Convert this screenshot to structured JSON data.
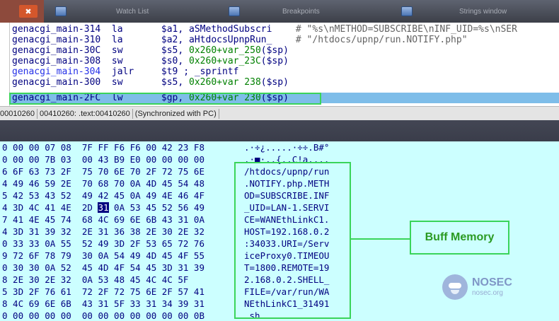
{
  "tabs": [
    {
      "label": "",
      "close": "✖"
    },
    {
      "label": "Watch List"
    },
    {
      "label": "Breakpoints"
    },
    {
      "label": "Strings window"
    }
  ],
  "disassembly": [
    {
      "addr": "genacgi_main-314",
      "op": "la",
      "args": "$a1, aSMethodSubscri",
      "comment": "# \"%s\\nMETHOD=SUBSCRIBE\\nINF_UID=%s\\nSER"
    },
    {
      "addr": "genacgi_main-310",
      "op": "la",
      "args": "$a2, aHtdocsUpnpRun_",
      "comment": "# \"/htdocs/upnp/run.NOTIFY.php\""
    },
    {
      "addr": "genacgi_main-30C",
      "op": "sw",
      "args_pre": "$s5, ",
      "args_num": "0x260+var_250",
      "args_post": "($sp)"
    },
    {
      "addr": "genacgi_main-308",
      "op": "sw",
      "args_pre": "$s0, ",
      "args_num": "0x260+var_23C",
      "args_post": "($sp)"
    },
    {
      "addr": "genacgi_main-304",
      "op": "jalr",
      "args": "$t9 ; _sprintf"
    },
    {
      "addr": "genacgi_main-300",
      "op": "sw",
      "args_pre": "$s5, ",
      "args_num": "0x260+var 238",
      "args_post": "($sp)"
    },
    {
      "addr": "genacgi_main-2FC",
      "op": "lw",
      "args_pre": "$gp, ",
      "args_num": "0x260+var 230",
      "args_post": "($sp)"
    }
  ],
  "status": {
    "offset": "00010260",
    "location": "00410260: .text:00410260",
    "sync": "(Synchronized with PC)"
  },
  "hex_rows": [
    {
      "pre": "0 00 00 07 08  7F FF F6 F6 00 42 23 F8  ",
      "ascii": ".·÷¿.....·÷÷.B#°"
    },
    {
      "pre": "0 00 00 7B 03  00 43 B9 E0 00 00 00 00  ",
      "ascii": ".·■·..{..C!a...."
    },
    {
      "pre": "6 6F 63 73 2F  75 70 6E 70 2F 72 75 6E  ",
      "ascii": "/htdocs/upnp/run"
    },
    {
      "pre": "4 49 46 59 2E  70 68 70 0A 4D 45 54 48  ",
      "ascii": ".NOTIFY.php.METH"
    },
    {
      "pre": "5 42 53 43 52  49 42 45 0A 49 4E 46 4F  ",
      "ascii": "OD=SUBSCRIBE.INF"
    },
    {
      "pre": "4 3D 4C 41 4E  2D ",
      "sel": "31",
      "post": " 0A 53 45 52 56 49  ",
      "ascii": "_UID=LAN-1.SERVI"
    },
    {
      "pre": "7 41 4E 45 74  68 4C 69 6E 6B 43 31 0A  ",
      "ascii": "CE=WANEthLinkC1."
    },
    {
      "pre": "4 3D 31 39 32  2E 31 36 38 2E 30 2E 32  ",
      "ascii": "HOST=192.168.0.2"
    },
    {
      "pre": "0 33 33 0A 55  52 49 3D 2F 53 65 72 76  ",
      "ascii": ":34033.URI=/Serv"
    },
    {
      "pre": "9 72 6F 78 79  30 0A 54 49 4D 45 4F 55  ",
      "ascii": "iceProxy0.TIMEOU"
    },
    {
      "pre": "0 30 30 0A 52  45 4D 4F 54 45 3D 31 39  ",
      "ascii": "T=1800.REMOTE=19"
    },
    {
      "pre": "8 2E 30 2E 32  0A 53 48 45 4C 4C 5F  ",
      "ascii": "2.168.0.2.SHELL_"
    },
    {
      "pre": "5 3D 2F 76 61  72 2F 72 75 6E 2F 57 41  ",
      "ascii": "FILE=/var/run/WA"
    },
    {
      "pre": "8 4C 69 6E 6B  43 31 5F 33 31 34 39 31  ",
      "ascii": "NEthLinkC1_31491"
    },
    {
      "pre": "0 00 00 00 00  00 00 00 00 00 00 00 0B  ",
      "ascii": ".sh............."
    }
  ],
  "annotation": {
    "label": "Buff Memory"
  },
  "watermark": {
    "name": "NOSEC",
    "url": "nosec.org"
  },
  "colors": {
    "highlight": "#3ad45a",
    "current_line": "#7ebde9",
    "hex_bg": "#ccffff"
  }
}
